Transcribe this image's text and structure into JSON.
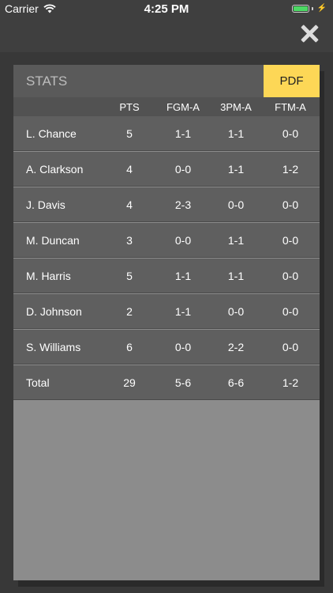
{
  "status_bar": {
    "carrier": "Carrier",
    "time": "4:25 PM",
    "battery_color": "#4cd964"
  },
  "panel": {
    "title": "STATS",
    "pdf_label": "PDF",
    "pdf_color": "#fdd756"
  },
  "table": {
    "headers": [
      "PTS",
      "FGM-A",
      "3PM-A",
      "FTM-A"
    ],
    "rows": [
      {
        "name": "L. Chance",
        "pts": "5",
        "fgm": "1-1",
        "tpm": "1-1",
        "ftm": "0-0"
      },
      {
        "name": "A. Clarkson",
        "pts": "4",
        "fgm": "0-0",
        "tpm": "1-1",
        "ftm": "1-2"
      },
      {
        "name": "J. Davis",
        "pts": "4",
        "fgm": "2-3",
        "tpm": "0-0",
        "ftm": "0-0"
      },
      {
        "name": "M. Duncan",
        "pts": "3",
        "fgm": "0-0",
        "tpm": "1-1",
        "ftm": "0-0"
      },
      {
        "name": "M. Harris",
        "pts": "5",
        "fgm": "1-1",
        "tpm": "1-1",
        "ftm": "0-0"
      },
      {
        "name": "D. Johnson",
        "pts": "2",
        "fgm": "1-1",
        "tpm": "0-0",
        "ftm": "0-0"
      },
      {
        "name": "S. Williams",
        "pts": "6",
        "fgm": "0-0",
        "tpm": "2-2",
        "ftm": "0-0"
      },
      {
        "name": "Total",
        "pts": "29",
        "fgm": "5-6",
        "tpm": "6-6",
        "ftm": "1-2"
      }
    ]
  }
}
